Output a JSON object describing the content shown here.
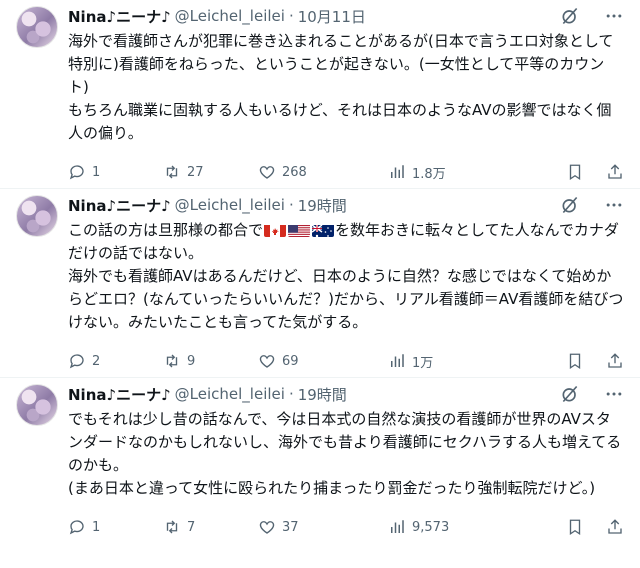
{
  "tweets": [
    {
      "name": "Nina♪ニーナ♪",
      "handle": "@Leichel_leilei",
      "dot": "·",
      "time": "10月11日",
      "text": "海外で看護師さんが犯罪に巻き込まれることがあるが(日本で言うエロ対象として特別に)看護師をねらった、ということが起きない。(一女性として平等のカウント)\nもちろん職業に固執する人もいるけど、それは日本のようなAVの影響ではなく個人の偏り。",
      "replies": "1",
      "retweets": "27",
      "likes": "268",
      "views": "1.8万"
    },
    {
      "name": "Nina♪ニーナ♪",
      "handle": "@Leichel_leilei",
      "dot": "·",
      "time": "19時間",
      "text_before": "この話の方は旦那様の都合で",
      "flags": [
        "canada-flag",
        "usa-flag",
        "australia-flag"
      ],
      "text_after": "を数年おきに転々としてた人なんでカナダだけの話ではない。\n海外でも看護師AVはあるんだけど、日本のように自然？な感じではなくて始めからどエロ？(なんていったらいいんだ？)だから、リアル看護師＝AV看護師を結びつけない。みたいたことも言ってた気がする。",
      "replies": "2",
      "retweets": "9",
      "likes": "69",
      "views": "1万"
    },
    {
      "name": "Nina♪ニーナ♪",
      "handle": "@Leichel_leilei",
      "dot": "·",
      "time": "19時間",
      "text": "でもそれは少し昔の話なんで、今は日本式の自然な演技の看護師が世界のAVスタンダードなのかもしれないし、海外でも昔より看護師にセクハラする人も増えてるのかも。\n(まあ日本と違って女性に殴られたり捕まったり罰金だったり強制転院だけど。)",
      "replies": "1",
      "retweets": "7",
      "likes": "37",
      "views": "9,573"
    }
  ],
  "colors": {
    "text": "#0f1419",
    "muted": "#536471",
    "border": "#eff3f4"
  }
}
